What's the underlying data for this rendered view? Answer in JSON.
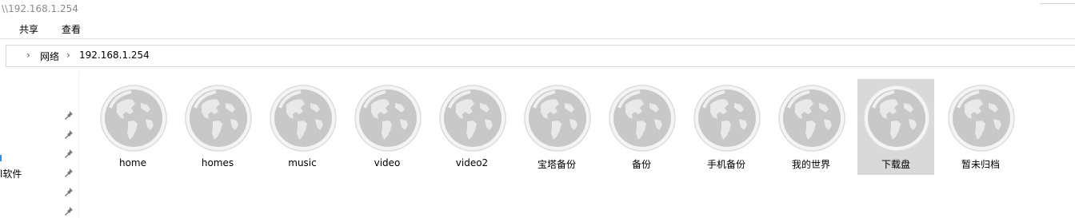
{
  "window": {
    "title": "\\\\192.168.1.254"
  },
  "ribbon": {
    "tabs": [
      "共享",
      "查看"
    ]
  },
  "address": {
    "crumbs": [
      "网络",
      "192.168.1.254"
    ]
  },
  "nav": {
    "partial_label": "l软件"
  },
  "folders": [
    {
      "label": "home",
      "selected": false
    },
    {
      "label": "homes",
      "selected": false
    },
    {
      "label": "music",
      "selected": false
    },
    {
      "label": "video",
      "selected": false
    },
    {
      "label": "video2",
      "selected": false
    },
    {
      "label": "宝塔备份",
      "selected": false
    },
    {
      "label": "备份",
      "selected": false
    },
    {
      "label": "手机备份",
      "selected": false
    },
    {
      "label": "我的世界",
      "selected": false
    },
    {
      "label": "下载盘",
      "selected": true
    },
    {
      "label": "暂未归档",
      "selected": false
    }
  ],
  "colors": {
    "selection": "#d9d9d9",
    "globe": "#c8c8c8",
    "accent": "#3c8ede"
  }
}
